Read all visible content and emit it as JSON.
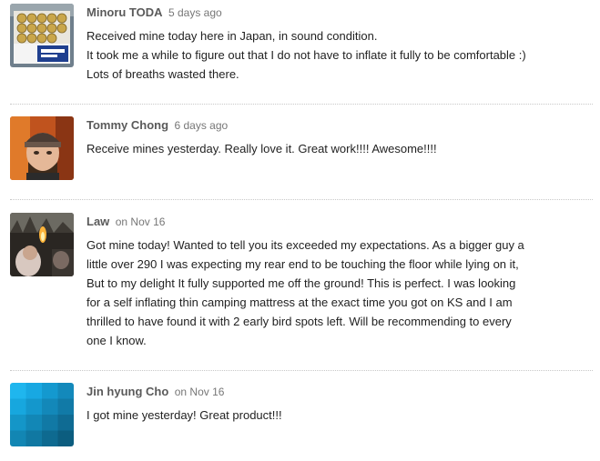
{
  "comments": [
    {
      "author": "Minoru TODA",
      "date": "5 days ago",
      "avatar_icon": "avatar-photo-box-of-cans",
      "lines": [
        "Received mine today here in Japan, in sound condition.",
        "It took me a while to figure out that I do not have to inflate it fully to be comfortable :)",
        "Lots of breaths wasted there."
      ]
    },
    {
      "author": "Tommy Chong",
      "date": "6 days ago",
      "avatar_icon": "avatar-photo-man-knit-hat",
      "lines": [
        "Receive mines yesterday. Really love it. Great work!!!! Awesome!!!!"
      ]
    },
    {
      "author": "Law",
      "date": "on Nov 16",
      "avatar_icon": "avatar-photo-campfire-night",
      "lines": [
        "Got mine today! Wanted to tell you its exceeded my expectations. As a bigger guy a",
        "little over 290 I was expecting my rear end to be touching the floor while lying on it,",
        "But to my delight It fully supported me off the ground! This is perfect. I was looking",
        "for a self inflating thin camping mattress at the exact time you got on KS and I am",
        "thrilled to have found it with 2 early bird spots left. Will be recommending to every",
        "one I know."
      ]
    },
    {
      "author": "Jin hyung Cho",
      "date": "on Nov 16",
      "avatar_icon": "avatar-default-blue-grid",
      "lines": [
        "I got mine yesterday! Great product!!!"
      ]
    }
  ]
}
